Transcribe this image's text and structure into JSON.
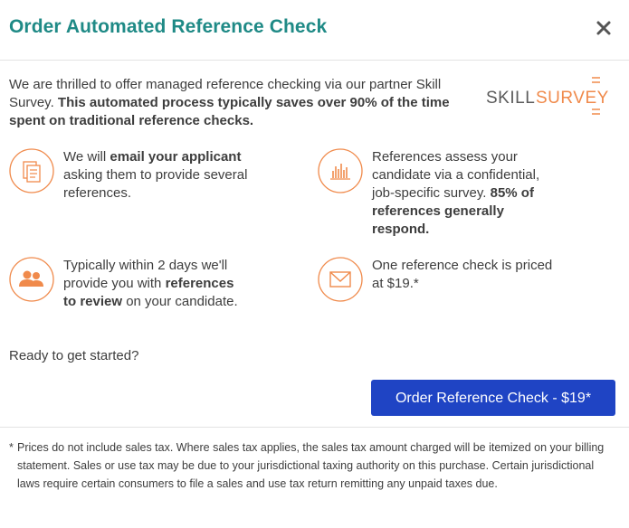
{
  "header": {
    "title": "Order Automated Reference Check",
    "close_icon": "close-icon"
  },
  "intro": {
    "text_plain": "We are thrilled to offer managed reference checking via our partner Skill Survey. ",
    "text_bold": "This automated process typically saves over 90% of the time spent on traditional reference checks."
  },
  "logo": {
    "part1": "SKILL",
    "part2": "SURVEY",
    "icon": "skillsurvey-logo"
  },
  "features": [
    {
      "icon": "documents-icon",
      "t1": "We will ",
      "b1": "email your applicant",
      "t2": " asking them to provide several references."
    },
    {
      "icon": "bar-chart-icon",
      "t1": "References assess your candidate via a confidential, job-specific survey. ",
      "b1": "85% of references generally respond."
    },
    {
      "icon": "users-icon",
      "t1": "Typically within 2 days we'll provide you with ",
      "b1": "references to review",
      "t2": " on your candidate."
    },
    {
      "icon": "envelope-icon",
      "t1": "One reference check is priced at $19.*"
    }
  ],
  "ready_text": "Ready to get started?",
  "order_button_label": "Order Reference Check - $19*",
  "footnote": {
    "star": "*",
    "text": "Prices do not include sales tax. Where sales tax applies, the sales tax amount charged will be itemized on your billing statement. Sales or use tax may be due to your jurisdictional taxing authority on this purchase. Certain jurisdictional laws require certain consumers to file a sales and use tax return remitting any unpaid taxes due."
  },
  "colors": {
    "title": "#1f8a86",
    "accent_orange": "#f08a4b",
    "button_bg": "#1f44c4",
    "logo_gray": "#5b5b5b"
  }
}
